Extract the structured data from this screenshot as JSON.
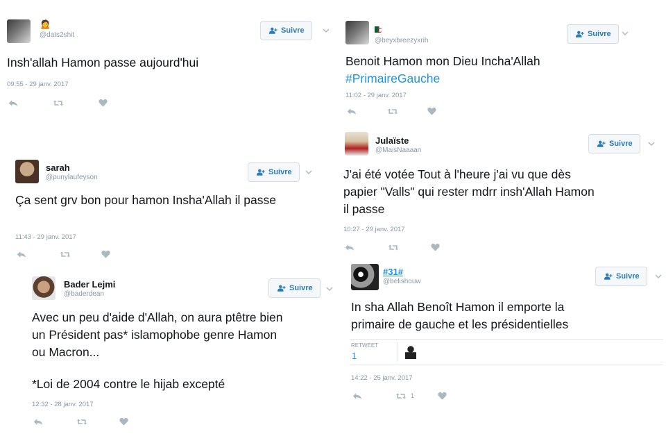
{
  "colors": {
    "link": "#1b95e0",
    "muted": "#8899a6",
    "text": "#14171a",
    "follow": "#2a7ab8"
  },
  "follow_label": "Suivre",
  "tweets": [
    {
      "handle": "@dats2shit",
      "fullname": "",
      "name_emoji": "🙍",
      "text": "Insh'allah Hamon passe aujourd'hui",
      "time": "09:55 - 29 janv. 2017"
    },
    {
      "handle": "@punylaufeyson",
      "fullname": "sarah",
      "text": "Ça sent grv bon pour hamon Insha'Allah il passe",
      "time": "11:43 - 29 janv. 2017"
    },
    {
      "handle": "@baderdean",
      "fullname": "Bader Lejmi",
      "text_lines": [
        "Avec un peu d'aide d'Allah, on aura ptêtre bien",
        "un Président pas* islamophobe genre Hamon",
        "ou Macron...",
        "",
        "*Loi de 2004 contre le hijab excepté"
      ],
      "time": "12:32 - 28 janv. 2017"
    },
    {
      "handle": "@beyxbreezyxrih",
      "fullname": "",
      "name_icon": "algeria-flag",
      "text": "Benoit Hamon mon Dieu Incha'Allah",
      "hashtag": "#PrimaireGauche",
      "time": "11:02 - 29 janv. 2017"
    },
    {
      "handle": "@MaisNaaaan",
      "fullname": "Julaïste",
      "text_lines": [
        "J'ai été votée Tout à l'heure j'ai vu que dès",
        "papier \"Valls\" qui rester mdrr insh'Allah Hamon",
        "il passe"
      ],
      "time": "10:27 - 29 janv. 2017"
    },
    {
      "handle": "@belishouw",
      "fullname": "#31#",
      "text_lines": [
        "In sha Allah Benoît Hamon il emporte la",
        "primaire de gauche et les présidentielles"
      ],
      "retweet_label": "RETWEET",
      "retweet_count": "1",
      "action_retweet_count": "1",
      "time": "14:22 - 25 janv. 2017"
    }
  ]
}
